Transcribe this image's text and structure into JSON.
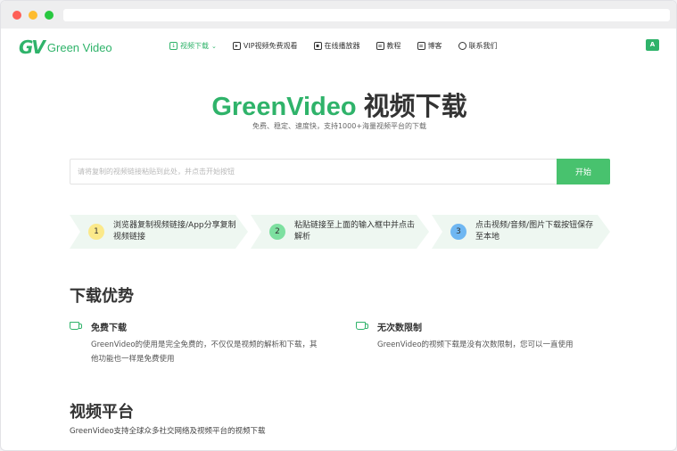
{
  "nav": {
    "logo_mark": "GV",
    "logo_text": "Green Video",
    "items": [
      {
        "label": "视频下载",
        "icon": "download-icon",
        "active": true
      },
      {
        "label": "VIP视频免费观看",
        "icon": "play-icon",
        "active": false
      },
      {
        "label": "在线播放器",
        "icon": "player-icon",
        "active": false
      },
      {
        "label": "教程",
        "icon": "book-icon",
        "active": false
      },
      {
        "label": "博客",
        "icon": "blog-icon",
        "active": false
      },
      {
        "label": "联系我们",
        "icon": "headset-icon",
        "active": false
      }
    ],
    "lang_icon": "translate-icon"
  },
  "hero": {
    "title_brand": "GreenVideo",
    "title_rest": " 视频下载",
    "subtitle": "免费、稳定、速度快，支持1000+海量视频平台的下载"
  },
  "search": {
    "placeholder": "请将复制的视频链接粘贴到此处，并点击开始按钮",
    "value": "",
    "button_label": "开始"
  },
  "steps": [
    {
      "num": "1",
      "text": "浏览器复制视频链接/App分享复制视频链接",
      "circle_color": "#fbe98a"
    },
    {
      "num": "2",
      "text": "粘贴链接至上面的输入框中并点击解析",
      "circle_color": "#7de0a0"
    },
    {
      "num": "3",
      "text": "点击视频/音频/图片下载按钮保存至本地",
      "circle_color": "#6fb7f2"
    }
  ],
  "advantages": {
    "title": "下载优势",
    "items": [
      {
        "name": "免费下载",
        "desc": "GreenVideo的使用是完全免费的，不仅仅是视频的解析和下载，其他功能也一样是免费使用"
      },
      {
        "name": "无次数限制",
        "desc": "GreenVideo的视频下载是没有次数限制，您可以一直使用"
      }
    ]
  },
  "platforms": {
    "title": "视频平台",
    "desc": "GreenVideo支持全球众多社交网络及视频平台的视频下载"
  },
  "colors": {
    "accent": "#2fb36a",
    "button": "#48c26e",
    "step_bg": "#eef7f1"
  }
}
